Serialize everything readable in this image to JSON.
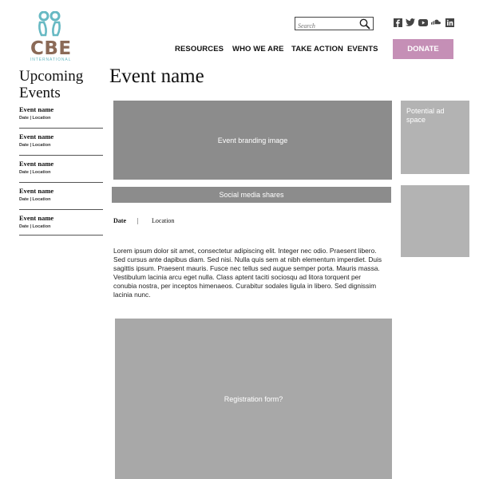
{
  "brand": {
    "logo_text": "CBE",
    "logo_subtext": "INTERNATIONAL",
    "colors": {
      "primary_brown": "#8b6a57",
      "teal": "#67b9c3",
      "donate": "#c58fb6",
      "placeholder_gray": "#8c8c8c",
      "light_gray": "#b3b3b3"
    }
  },
  "search": {
    "placeholder": "Search",
    "icon": "magnifier-icon"
  },
  "socials": [
    "facebook-icon",
    "twitter-icon",
    "youtube-icon",
    "soundcloud-icon",
    "linkedin-icon"
  ],
  "nav": {
    "items": [
      "RESOURCES",
      "WHO WE ARE",
      "TAKE ACTION",
      "EVENTS"
    ],
    "donate": "DONATE"
  },
  "sidebar": {
    "title_line1": "Upcoming",
    "title_line2": "Events",
    "events": [
      {
        "name": "Event name",
        "meta": "Date | Location"
      },
      {
        "name": "Event name",
        "meta": "Date | Location"
      },
      {
        "name": "Event name",
        "meta": "Date | Location"
      },
      {
        "name": "Event name",
        "meta": "Date | Location"
      },
      {
        "name": "Event name",
        "meta": "Date | Location"
      }
    ]
  },
  "main": {
    "title": "Event name",
    "branding_label": "Event branding image",
    "social_shares_label": "Social media shares",
    "date_label": "Date",
    "separator": "|",
    "location_label": "Location",
    "body": "Lorem ipsum dolor sit amet, consectetur adipiscing elit. Integer nec odio. Praesent libero. Sed cursus ante dapibus diam. Sed nisi. Nulla quis sem at nibh elementum imperdiet. Duis sagittis ipsum. Praesent mauris. Fusce nec tellus sed augue semper porta. Mauris massa. Vestibulum lacinia arcu eget nulla. Class aptent taciti sociosqu ad litora torquent per conubia nostra, per inceptos himenaeos. Curabitur sodales ligula in libero. Sed dignissim lacinia nunc.",
    "registration_label": "Registration form?"
  },
  "ads": {
    "ad1_label": "Potential ad space"
  }
}
